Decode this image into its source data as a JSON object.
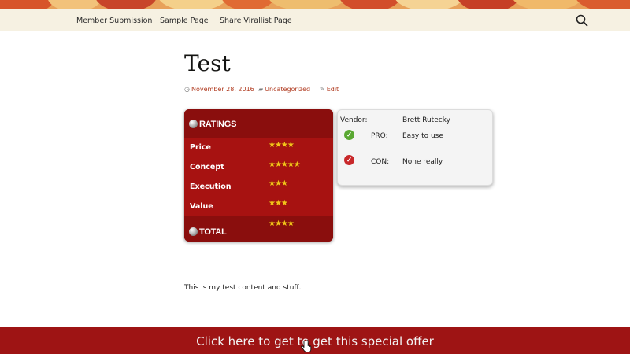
{
  "nav": {
    "items": [
      {
        "label": "Member Submission"
      },
      {
        "label": "Sample Page"
      },
      {
        "label": "Share Virallist Page"
      }
    ],
    "search_icon": "search-icon"
  },
  "post": {
    "title": "Test",
    "date": "November 28, 2016",
    "category": "Uncategorized",
    "edit_label": "Edit",
    "content": "This is my test content and stuff."
  },
  "ratings": {
    "heading": "Ratings",
    "rows": [
      {
        "label": "Price",
        "stars": "★★★★",
        "value": 4
      },
      {
        "label": "Concept",
        "stars": "★★★★★",
        "value": 5
      },
      {
        "label": "Execution",
        "stars": "★★★",
        "value": 3
      },
      {
        "label": "Value",
        "stars": "★★★",
        "value": 3
      }
    ],
    "total_label": "Total",
    "total_stars": "★★★★",
    "total_value": 4
  },
  "procon": {
    "vendor_label": "Vendor:",
    "vendor_value": "Brett Rutecky",
    "pro_label": "PRO:",
    "pro_value": "Easy to use",
    "con_label": "CON:",
    "con_value": "None really"
  },
  "offer": {
    "label": "Click here to get to get this special offer"
  },
  "colors": {
    "accent": "#b03a1f",
    "ratings_bg": "#a71211",
    "offer_bg": "#9e1414",
    "pro_green": "#5aa832",
    "con_red": "#c8282a",
    "star": "#f5c21a"
  }
}
